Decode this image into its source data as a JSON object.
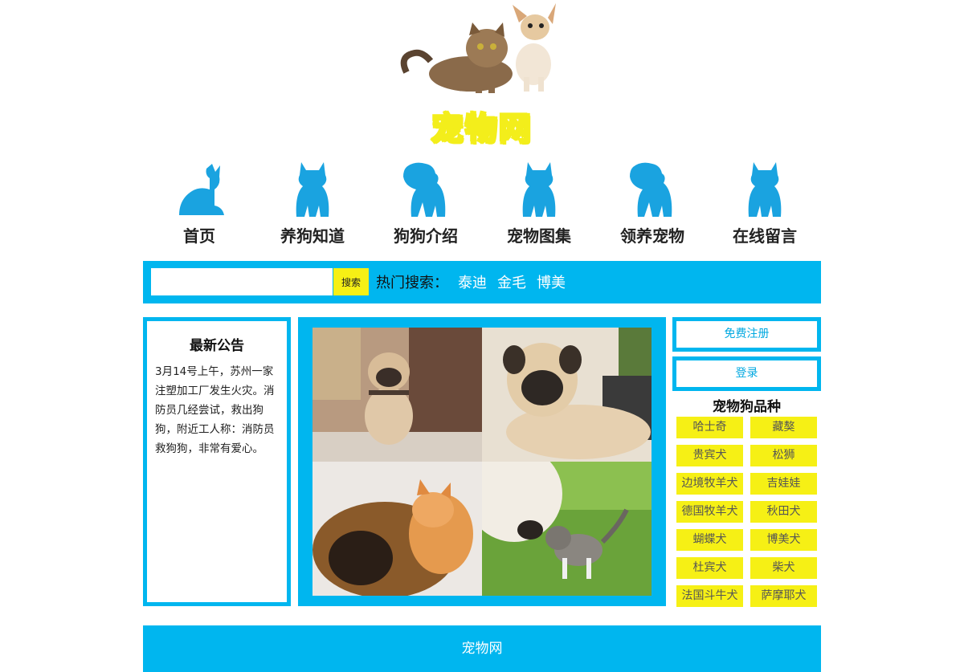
{
  "header": {
    "logo_title": "宠物网",
    "logo_art": "cat-and-chihuahua-photo"
  },
  "nav": {
    "items": [
      {
        "label": "首页",
        "icon": "sitting-cat-silhouette-icon"
      },
      {
        "label": "养狗知道",
        "icon": "kitten-silhouette-icon"
      },
      {
        "label": "狗狗介绍",
        "icon": "puppy-silhouette-icon"
      },
      {
        "label": "宠物图集",
        "icon": "kitten-silhouette-icon"
      },
      {
        "label": "领养宠物",
        "icon": "puppy-silhouette-icon"
      },
      {
        "label": "在线留言",
        "icon": "kitten-silhouette-icon"
      }
    ],
    "icon_color": "#1aa3e0"
  },
  "search": {
    "input_value": "",
    "button_label": "搜索",
    "hot_label": "热门搜索：",
    "hot_links": [
      "泰迪",
      "金毛",
      "博美"
    ]
  },
  "notice": {
    "title": "最新公告",
    "body": "3月14号上午，苏州一家注塑加工厂发生火灾。消防员几经尝试，救出狗狗，附近工人称：消防员救狗狗，非常有爱心。"
  },
  "gallery": {
    "photos": [
      "pug-sitting-photo",
      "pug-lying-photo",
      "german-shepherd-and-cat-photo",
      "dog-and-kitten-on-grass-photo"
    ]
  },
  "sidebar": {
    "register_label": "免费注册",
    "login_label": "登录",
    "breeds_title": "宠物狗品种",
    "breeds": [
      "哈士奇",
      "藏獒",
      "贵宾犬",
      "松狮",
      "边境牧羊犬",
      "吉娃娃",
      "德国牧羊犬",
      "秋田犬",
      "蝴蝶犬",
      "博美犬",
      "杜宾犬",
      "柴犬",
      "法国斗牛犬",
      "萨摩耶犬"
    ]
  },
  "footer": {
    "text": "宠物网"
  },
  "colors": {
    "accent": "#00b6ef",
    "yellow": "#f6f015"
  }
}
